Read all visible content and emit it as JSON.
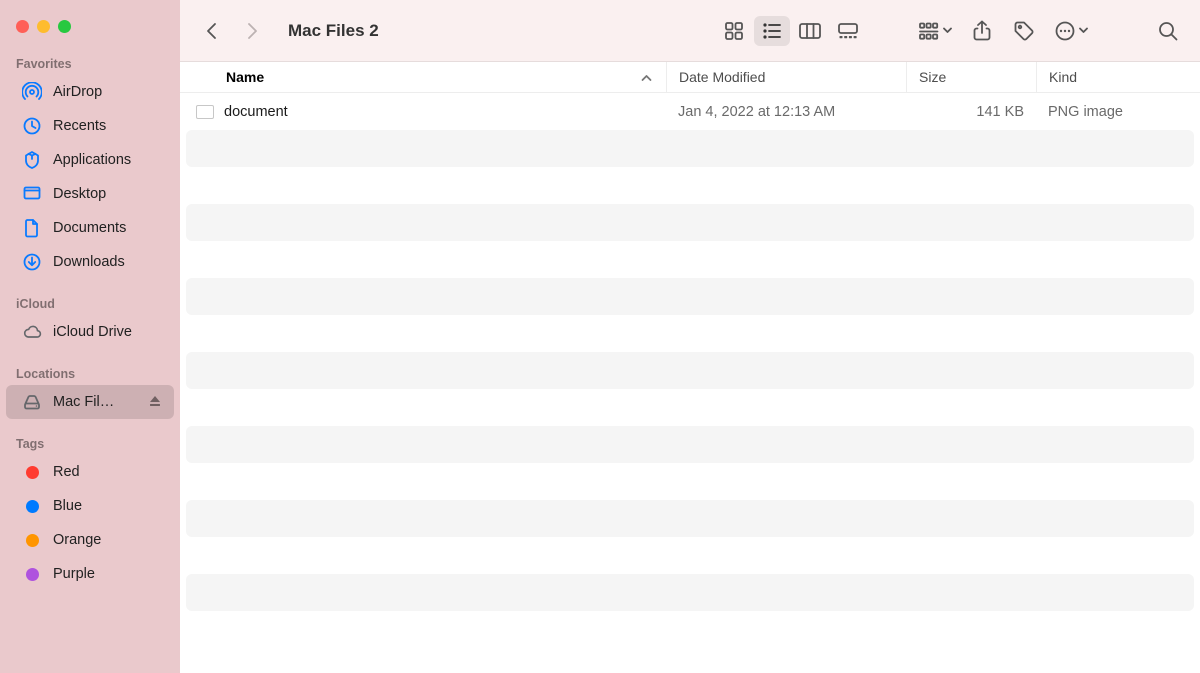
{
  "window": {
    "title": "Mac Files 2"
  },
  "sidebar": {
    "sections": [
      {
        "title": "Favorites",
        "items": [
          {
            "label": "AirDrop",
            "icon": "airdrop"
          },
          {
            "label": "Recents",
            "icon": "clock"
          },
          {
            "label": "Applications",
            "icon": "apps"
          },
          {
            "label": "Desktop",
            "icon": "desktop"
          },
          {
            "label": "Documents",
            "icon": "doc"
          },
          {
            "label": "Downloads",
            "icon": "downloads"
          }
        ]
      },
      {
        "title": "iCloud",
        "items": [
          {
            "label": "iCloud Drive",
            "icon": "cloud"
          }
        ]
      },
      {
        "title": "Locations",
        "items": [
          {
            "label": "Mac Fil…",
            "icon": "disk",
            "selected": true,
            "eject": true
          }
        ]
      },
      {
        "title": "Tags",
        "items": [
          {
            "label": "Red",
            "tagColor": "#ff3b30"
          },
          {
            "label": "Blue",
            "tagColor": "#007aff"
          },
          {
            "label": "Orange",
            "tagColor": "#ff9500"
          },
          {
            "label": "Purple",
            "tagColor": "#af52de"
          }
        ]
      }
    ]
  },
  "columns": {
    "name": "Name",
    "date": "Date Modified",
    "size": "Size",
    "kind": "Kind"
  },
  "files": [
    {
      "name": "document",
      "date": "Jan 4, 2022 at 12:13 AM",
      "size": "141 KB",
      "kind": "PNG image"
    }
  ],
  "emptyRows": 14
}
